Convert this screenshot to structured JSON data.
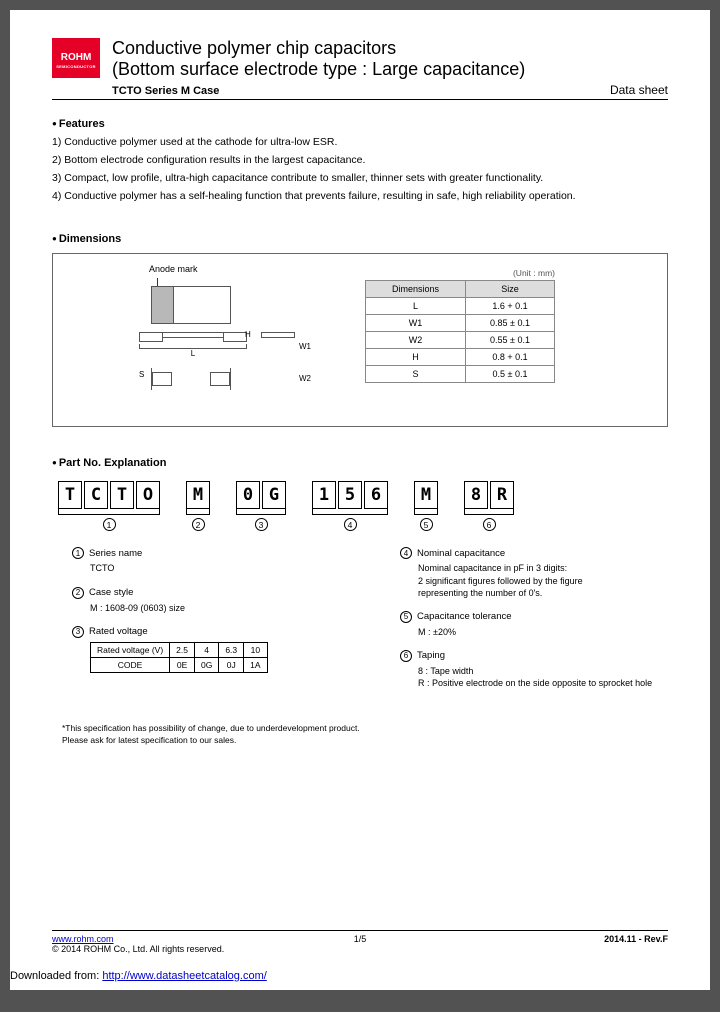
{
  "logo": {
    "main": "ROHM",
    "sub": "SEMICONDUCTOR"
  },
  "header": {
    "title1": "Conductive polymer chip capacitors",
    "title2": "(Bottom surface electrode type : Large capacitance)",
    "series": "TCTO Series M Case",
    "doctype": "Data sheet"
  },
  "sections": {
    "features_head": "Features",
    "features": [
      "1) Conductive polymer used at the cathode for ultra-low ESR.",
      "2) Bottom electrode configuration results in the largest capacitance.",
      "3) Compact, low profile, ultra-high capacitance contribute to smaller, thinner sets with greater functionality.",
      "4) Conductive polymer has a self-healing function that prevents failure, resulting in safe, high reliability operation."
    ],
    "dimensions_head": "Dimensions",
    "partno_head": "Part No. Explanation"
  },
  "dim_drawing": {
    "anode": "Anode mark",
    "L": "L",
    "W1": "W1",
    "W2": "W2",
    "H": "H",
    "S": "S"
  },
  "dim_table": {
    "unit": "(Unit : mm)",
    "headers": [
      "Dimensions",
      "Size"
    ],
    "rows": [
      [
        "L",
        "1.6 + 0.1"
      ],
      [
        "W1",
        "0.85 ± 0.1"
      ],
      [
        "W2",
        "0.55 ± 0.1"
      ],
      [
        "H",
        "0.8 + 0.1"
      ],
      [
        "S",
        "0.5 ± 0.1"
      ]
    ]
  },
  "partno": {
    "groups": [
      {
        "chars": [
          "T",
          "C",
          "T",
          "O"
        ],
        "num": "1"
      },
      {
        "chars": [
          "M"
        ],
        "num": "2"
      },
      {
        "chars": [
          "0",
          "G"
        ],
        "num": "3"
      },
      {
        "chars": [
          "1",
          "5",
          "6"
        ],
        "num": "4"
      },
      {
        "chars": [
          "M"
        ],
        "num": "5"
      },
      {
        "chars": [
          "8",
          "R"
        ],
        "num": "6"
      }
    ]
  },
  "explain": {
    "left": [
      {
        "n": "1",
        "title": "Series name",
        "body": "TCTO"
      },
      {
        "n": "2",
        "title": "Case style",
        "body": "M : 1608-09 (0603) size"
      },
      {
        "n": "3",
        "title": "Rated voltage",
        "table": {
          "r1": [
            "Rated voltage   (V)",
            "2.5",
            "4",
            "6.3",
            "10"
          ],
          "r2": [
            "CODE",
            "0E",
            "0G",
            "0J",
            "1A"
          ]
        }
      }
    ],
    "right": [
      {
        "n": "4",
        "title": "Nominal capacitance",
        "body": "Nominal capacitance in pF in 3 digits:\n2 significant figures followed by the figure\nrepresenting the number of 0's."
      },
      {
        "n": "5",
        "title": "Capacitance tolerance",
        "body": "M : ±20%"
      },
      {
        "n": "6",
        "title": "Taping",
        "body": "8 : Tape width\nR : Positive electrode on the side opposite to sprocket hole"
      }
    ]
  },
  "disclaimer": "*This specification has possibility of change, due to underdevelopment product.\n  Please ask for latest specification to our sales.",
  "footer": {
    "url": "www.rohm.com",
    "copyright": "© 2014 ROHM Co., Ltd. All rights reserved.",
    "page": "1/5",
    "rev": "2014.11 - Rev.F"
  },
  "downloaded": {
    "prefix": "Downloaded from: ",
    "url": "http://www.datasheetcatalog.com/"
  }
}
